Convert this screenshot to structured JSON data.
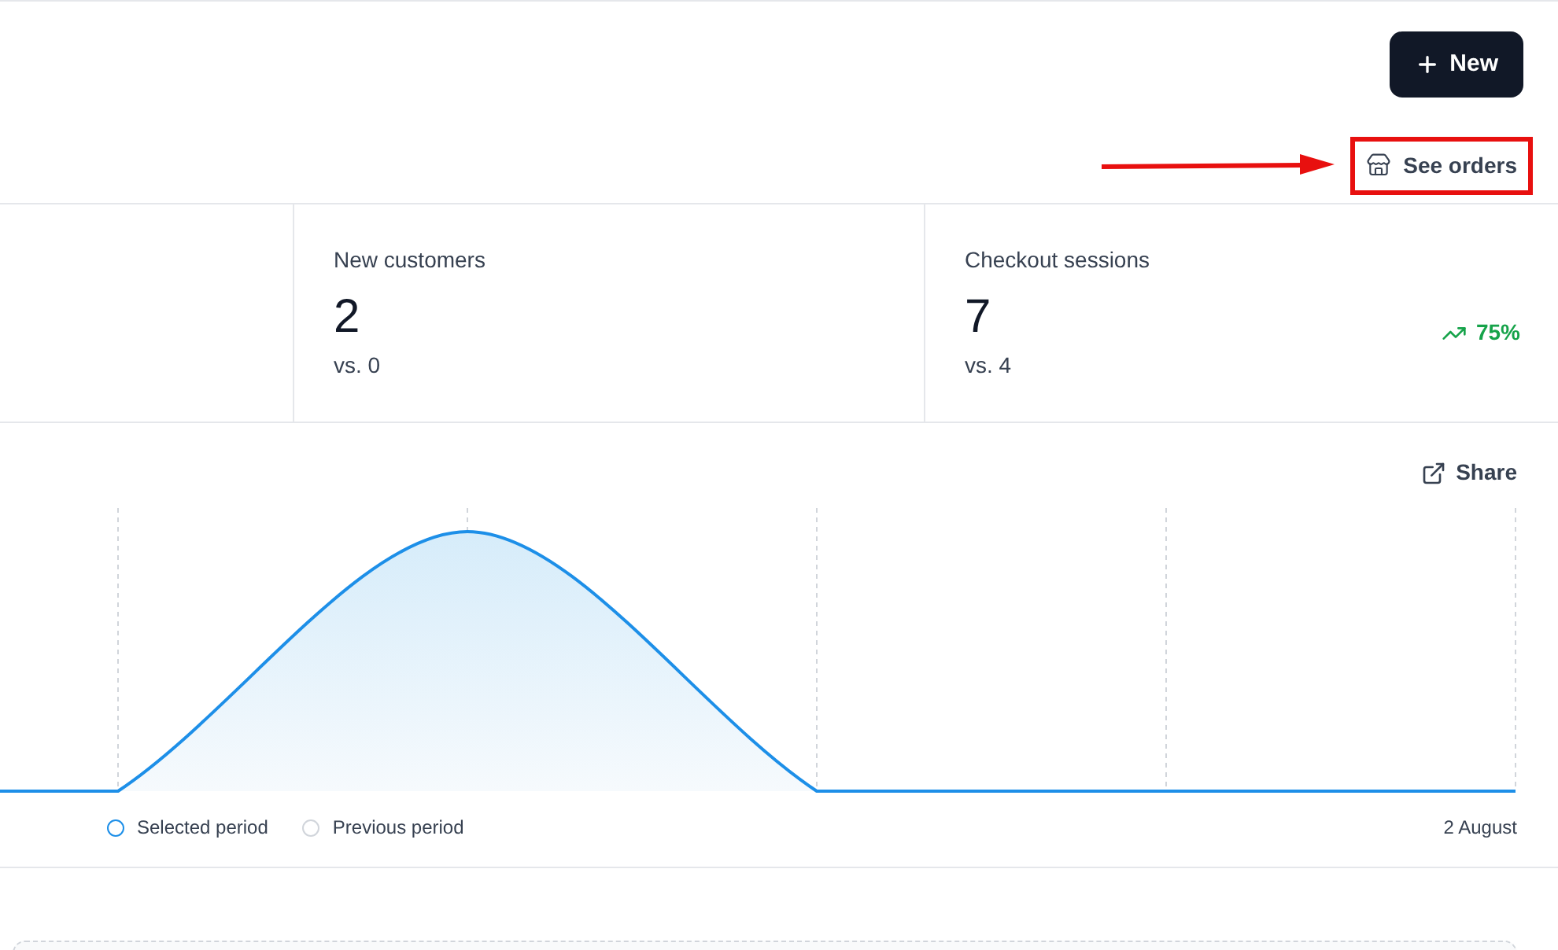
{
  "header": {
    "new_button": "New",
    "see_orders": "See orders",
    "annotation": {
      "highlighted": true
    }
  },
  "stats": [
    {
      "label": "New customers",
      "value": "2",
      "comparison": "vs. 0"
    },
    {
      "label": "Checkout sessions",
      "value": "7",
      "comparison": "vs. 4",
      "change": "75%"
    }
  ],
  "chart": {
    "share": "Share",
    "legend": [
      {
        "label": "Selected period",
        "color": "#1d8fe8"
      },
      {
        "label": "Previous period",
        "color": "#d1d5db"
      }
    ],
    "end_label": "2 August"
  }
}
